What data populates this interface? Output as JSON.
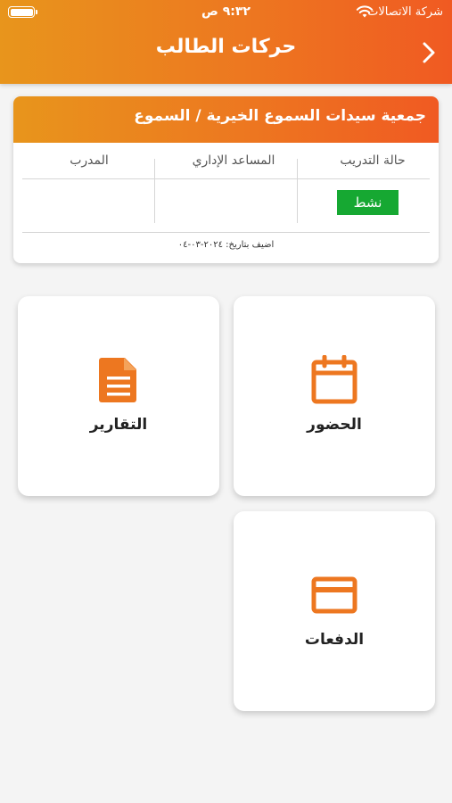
{
  "status_bar": {
    "carrier": "شركة الاتصالات",
    "time": "٩:٣٢ ص"
  },
  "header": {
    "title": "حركات الطالب",
    "back_icon": "chevron-right-icon"
  },
  "info_card": {
    "title": "جمعية سيدات السموع الخيرية  /  السموع",
    "columns": [
      "حالة التدريب",
      "المساعد الإداري",
      "المدرب"
    ],
    "status": "نشط",
    "status_color": "#16a832",
    "added_date": "اضيف بتاريخ: ٢٠٢٤-٠٣-٠٤"
  },
  "tiles": [
    {
      "label": "الحضور",
      "icon": "calendar-icon"
    },
    {
      "label": "التقارير",
      "icon": "document-icon"
    },
    {
      "label": "الدفعات",
      "icon": "credit-card-icon"
    }
  ],
  "colors": {
    "accent": "#ed7720",
    "header_gradient_start": "#e8951c",
    "header_gradient_end": "#f05a22"
  }
}
